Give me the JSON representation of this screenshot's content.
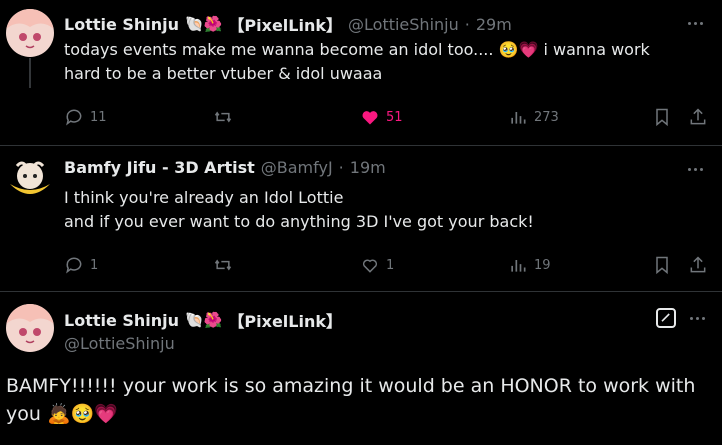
{
  "tweets": [
    {
      "display_name": "Lottie Shinju",
      "badges": "🐚🌺",
      "affiliation": "【PixelLink】",
      "handle": "@LottieShinju",
      "separator": "·",
      "time": "29m",
      "text_line1": "todays events make me wanna become an idol too.... 🥹💗 i wanna work",
      "text_line2": "hard to be a better vtuber & idol uwaaa",
      "stats": {
        "replies": "11",
        "retweets": "",
        "likes": "51",
        "views": "273"
      }
    },
    {
      "display_name": "Bamfy Jifu - 3D Artist",
      "handle": "@BamfyJ",
      "separator": "·",
      "time": "19m",
      "text_line1": "I think you're already an Idol Lottie",
      "text_line2": "and if you ever want to do anything 3D I've got your back!",
      "stats": {
        "replies": "1",
        "retweets": "",
        "likes": "1",
        "views": "19"
      }
    }
  ],
  "composer": {
    "display_name": "Lottie Shinju",
    "badges": "🐚🌺",
    "affiliation": "【PixelLink】",
    "handle": "@LottieShinju",
    "text_line1": "BAMFY!!!!!! your work is so amazing it would be an HONOR to work with",
    "text_line2": "you 🙇🥹💗"
  },
  "colors": {
    "like": "#f91880",
    "muted": "#71767b",
    "text": "#e7e9ea",
    "background": "#000000"
  },
  "icons": [
    "reply-icon",
    "retweet-icon",
    "heart-icon",
    "views-icon",
    "bookmark-icon",
    "share-icon",
    "more-icon",
    "edit-icon"
  ]
}
